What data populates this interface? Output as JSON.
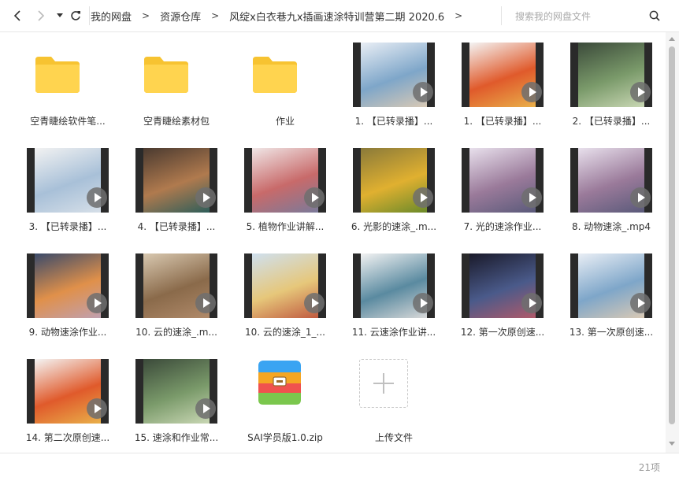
{
  "nav": {
    "back_icon": "chevron-left-icon",
    "forward_icon": "chevron-right-icon",
    "dropdown_icon": "caret-down-icon",
    "refresh_icon": "refresh-icon"
  },
  "breadcrumb": [
    "我的网盘",
    "资源仓库",
    "风绽x白衣巷九x插画速涂特训营第二期 2020.6"
  ],
  "breadcrumb_sep": ">",
  "search": {
    "placeholder": "搜索我的网盘文件",
    "value": ""
  },
  "colors": {
    "folder": "#FFD44F",
    "folder_back": "#F7C331",
    "accent": "#2F8EF2"
  },
  "files": [
    {
      "name": "空青睫绘软件笔...",
      "type": "folder"
    },
    {
      "name": "空青睫绘素材包",
      "type": "folder"
    },
    {
      "name": "作业",
      "type": "folder"
    },
    {
      "name": "1. 【已转录播】...",
      "type": "video"
    },
    {
      "name": "1. 【已转录播】...",
      "type": "video"
    },
    {
      "name": "2. 【已转录播】...",
      "type": "video"
    },
    {
      "name": "3. 【已转录播】...",
      "type": "video"
    },
    {
      "name": "4. 【已转录播】...",
      "type": "video"
    },
    {
      "name": "5. 植物作业讲解...",
      "type": "video"
    },
    {
      "name": "6. 光影的速涂_.m...",
      "type": "video"
    },
    {
      "name": "7. 光的速涂作业...",
      "type": "video"
    },
    {
      "name": "8. 动物速涂_.mp4",
      "type": "video"
    },
    {
      "name": "9. 动物速涂作业...",
      "type": "video"
    },
    {
      "name": "10. 云的速涂_.m...",
      "type": "video"
    },
    {
      "name": "10. 云的速涂_1_...",
      "type": "video"
    },
    {
      "name": "11. 云速涂作业讲...",
      "type": "video"
    },
    {
      "name": "12. 第一次原创速...",
      "type": "video"
    },
    {
      "name": "13. 第一次原创速...",
      "type": "video"
    },
    {
      "name": "14. 第二次原创速...",
      "type": "video"
    },
    {
      "name": "15. 速涂和作业常...",
      "type": "video"
    },
    {
      "name": "SAI学员版1.0.zip",
      "type": "zip"
    },
    {
      "name": "上传文件",
      "type": "upload"
    }
  ],
  "status": {
    "count": "21项"
  }
}
